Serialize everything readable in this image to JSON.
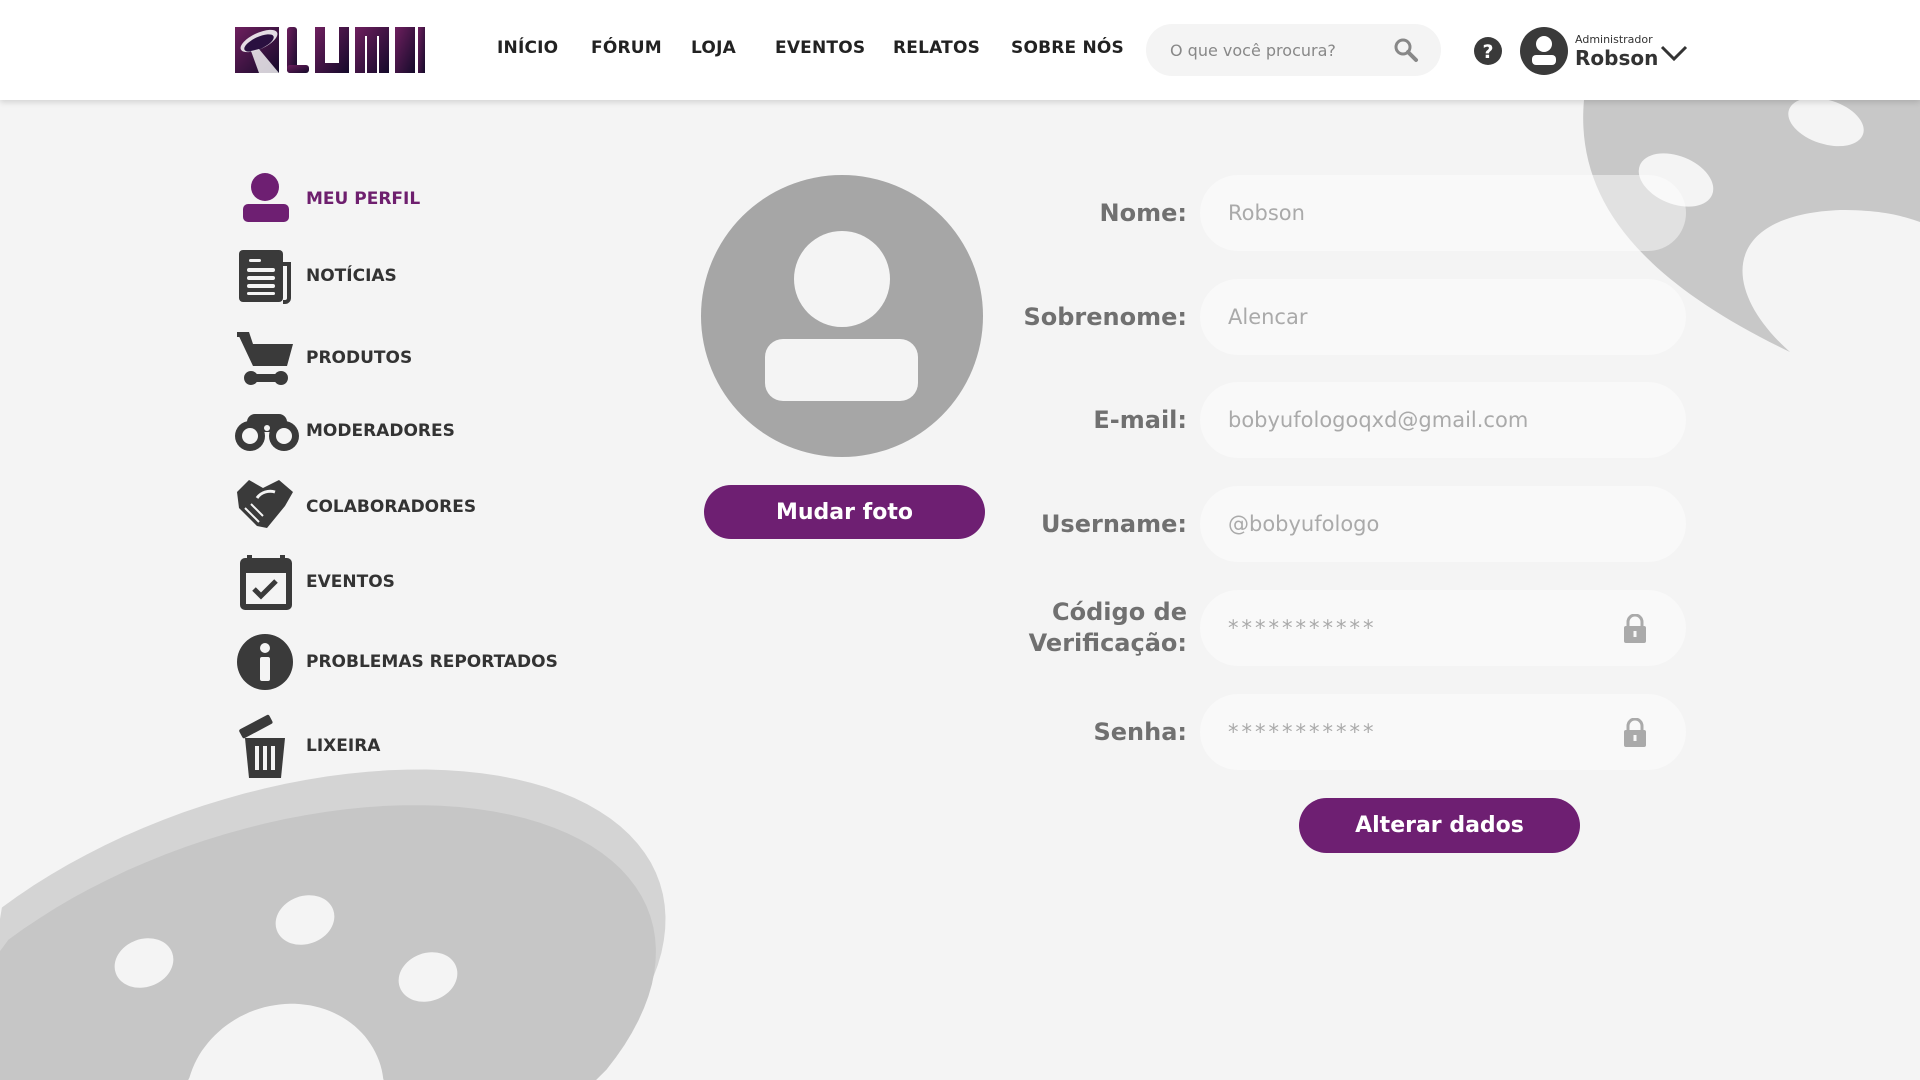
{
  "header": {
    "logo_text": "LUMNI",
    "nav": [
      "INÍCIO",
      "FÓRUM",
      "LOJA",
      "EVENTOS",
      "RELATOS",
      "SOBRE NÓS"
    ],
    "search_placeholder": "O que você procura?",
    "user_role": "Administrador",
    "user_name": "Robson"
  },
  "sidebar": {
    "items": [
      {
        "label": "MEU PERFIL",
        "icon": "user-icon",
        "active": true
      },
      {
        "label": "NOTÍCIAS",
        "icon": "newspaper-icon"
      },
      {
        "label": "PRODUTOS",
        "icon": "cart-icon"
      },
      {
        "label": "MODERADORES",
        "icon": "binoculars-icon"
      },
      {
        "label": "COLABORADORES",
        "icon": "handshake-icon"
      },
      {
        "label": "EVENTOS",
        "icon": "calendar-check-icon"
      },
      {
        "label": "PROBLEMAS REPORTADOS",
        "icon": "info-icon"
      },
      {
        "label": "LIXEIRA",
        "icon": "trash-icon"
      }
    ]
  },
  "profile": {
    "change_photo": "Mudar foto"
  },
  "form": {
    "fields": [
      {
        "label": "Nome:",
        "value": "Robson"
      },
      {
        "label": "Sobrenome:",
        "value": "Alencar"
      },
      {
        "label": "E-mail:",
        "value": "bobyufologoqxd@gmail.com"
      },
      {
        "label": "Username:",
        "value": "@bobyufologo"
      },
      {
        "label": "Código de Verificação:",
        "value": "***********"
      },
      {
        "label": "Senha:",
        "value": "***********"
      }
    ],
    "submit": "Alterar dados"
  },
  "colors": {
    "accent": "#6e1f72",
    "icon": "#3a3a3a",
    "bg": "#f4f4f4"
  }
}
